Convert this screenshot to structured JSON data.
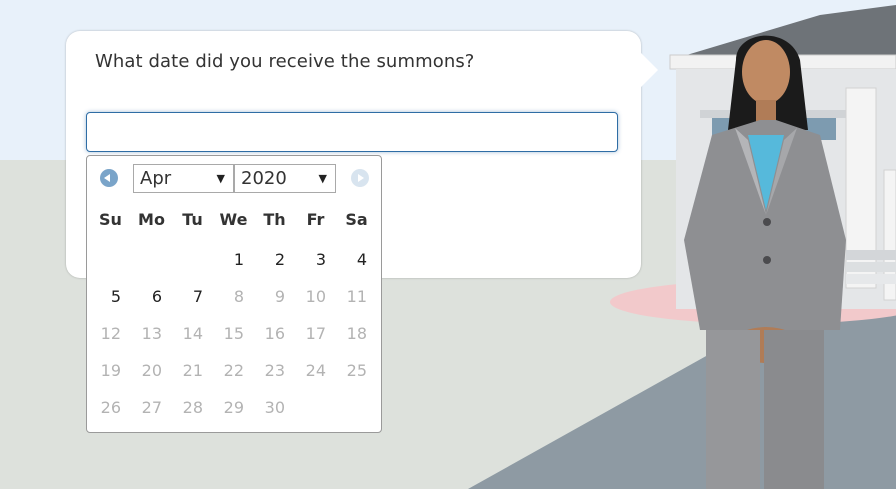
{
  "question": "What date did you receive the summons?",
  "input": {
    "value": "",
    "placeholder": ""
  },
  "datepicker": {
    "prev_icon": "circle-arrow-left-icon",
    "next_icon": "circle-arrow-right-icon",
    "month": "Apr",
    "year": "2020",
    "weekdays": [
      "Su",
      "Mo",
      "Tu",
      "We",
      "Th",
      "Fr",
      "Sa"
    ],
    "weeks": [
      [
        {
          "d": "",
          "s": "empty"
        },
        {
          "d": "",
          "s": "empty"
        },
        {
          "d": "",
          "s": "empty"
        },
        {
          "d": "1",
          "s": "enabled"
        },
        {
          "d": "2",
          "s": "enabled"
        },
        {
          "d": "3",
          "s": "enabled"
        },
        {
          "d": "4",
          "s": "enabled"
        }
      ],
      [
        {
          "d": "5",
          "s": "enabled"
        },
        {
          "d": "6",
          "s": "enabled"
        },
        {
          "d": "7",
          "s": "enabled"
        },
        {
          "d": "8",
          "s": "disabled"
        },
        {
          "d": "9",
          "s": "disabled"
        },
        {
          "d": "10",
          "s": "disabled"
        },
        {
          "d": "11",
          "s": "disabled"
        }
      ],
      [
        {
          "d": "12",
          "s": "disabled"
        },
        {
          "d": "13",
          "s": "disabled"
        },
        {
          "d": "14",
          "s": "disabled"
        },
        {
          "d": "15",
          "s": "disabled"
        },
        {
          "d": "16",
          "s": "disabled"
        },
        {
          "d": "17",
          "s": "disabled"
        },
        {
          "d": "18",
          "s": "disabled"
        }
      ],
      [
        {
          "d": "19",
          "s": "disabled"
        },
        {
          "d": "20",
          "s": "disabled"
        },
        {
          "d": "21",
          "s": "disabled"
        },
        {
          "d": "22",
          "s": "disabled"
        },
        {
          "d": "23",
          "s": "disabled"
        },
        {
          "d": "24",
          "s": "disabled"
        },
        {
          "d": "25",
          "s": "disabled"
        }
      ],
      [
        {
          "d": "26",
          "s": "disabled"
        },
        {
          "d": "27",
          "s": "disabled"
        },
        {
          "d": "28",
          "s": "disabled"
        },
        {
          "d": "29",
          "s": "disabled"
        },
        {
          "d": "30",
          "s": "disabled"
        },
        {
          "d": "",
          "s": "empty"
        },
        {
          "d": "",
          "s": "empty"
        }
      ]
    ]
  },
  "colors": {
    "input_focus_border": "#2f6da5",
    "enabled_day": "#222222",
    "disabled_day": "#b3b3b3",
    "sky": "#e8f1fa",
    "ground": "#dde1dc",
    "road": "#8e9aa3"
  }
}
